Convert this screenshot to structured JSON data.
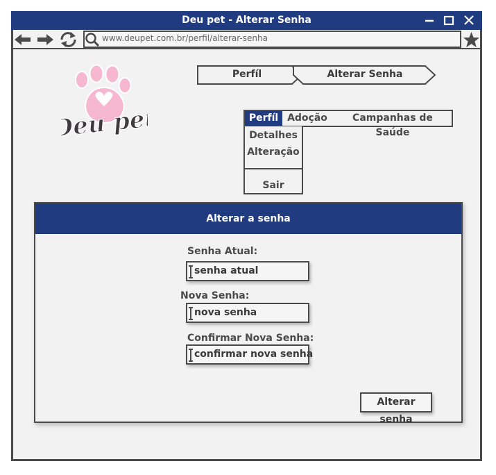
{
  "window": {
    "title": "Deu pet - Alterar Senha"
  },
  "browser": {
    "url": "www.deupet.com.br/perfil/alterar-senha"
  },
  "logo": {
    "text": "Deu pet"
  },
  "breadcrumb": [
    "Perfíl",
    "Alterar Senha"
  ],
  "menu": {
    "items": [
      "Perfíl",
      "Adoção",
      "Campanhas de Saúde"
    ],
    "dropdown": [
      "Detalhes",
      "Alteração",
      "Sair"
    ]
  },
  "form": {
    "title": "Alterar a senha",
    "fields": [
      {
        "label": "Senha Atual:",
        "placeholder": "senha atual"
      },
      {
        "label": "Nova Senha:",
        "placeholder": "nova senha"
      },
      {
        "label": "Confirmar Nova Senha:",
        "placeholder": "confirmar nova senha"
      }
    ],
    "submit_label": "Alterar senha"
  },
  "colors": {
    "accent": "#213b80",
    "border": "#4a4a4a",
    "background": "#f2f2f2",
    "logo_pink": "#f6b8cf"
  }
}
